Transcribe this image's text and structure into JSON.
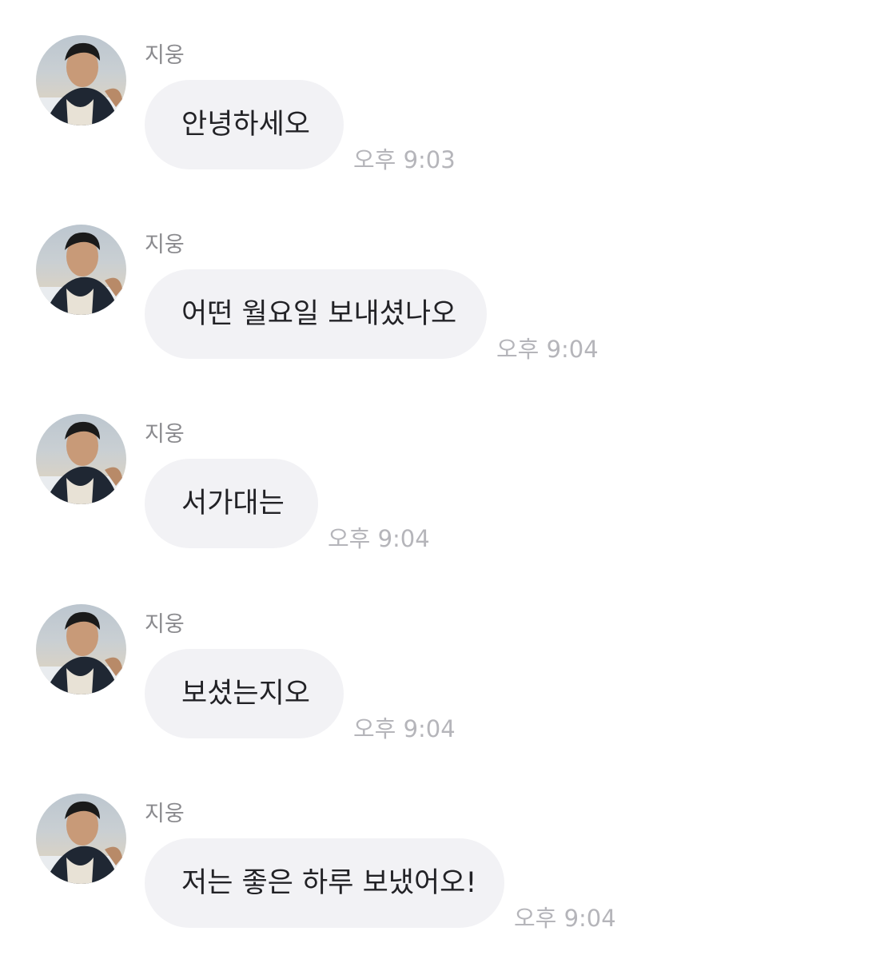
{
  "messages": [
    {
      "sender": "지웅",
      "text": "안녕하세오",
      "time": "오후 9:03"
    },
    {
      "sender": "지웅",
      "text": "어떤 월요일 보내셨나오",
      "time": "오후 9:04"
    },
    {
      "sender": "지웅",
      "text": "서가대는",
      "time": "오후 9:04"
    },
    {
      "sender": "지웅",
      "text": "보셨는지오",
      "time": "오후 9:04"
    },
    {
      "sender": "지웅",
      "text": "저는 좋은 하루 보냈어오!",
      "time": "오후 9:04"
    }
  ]
}
